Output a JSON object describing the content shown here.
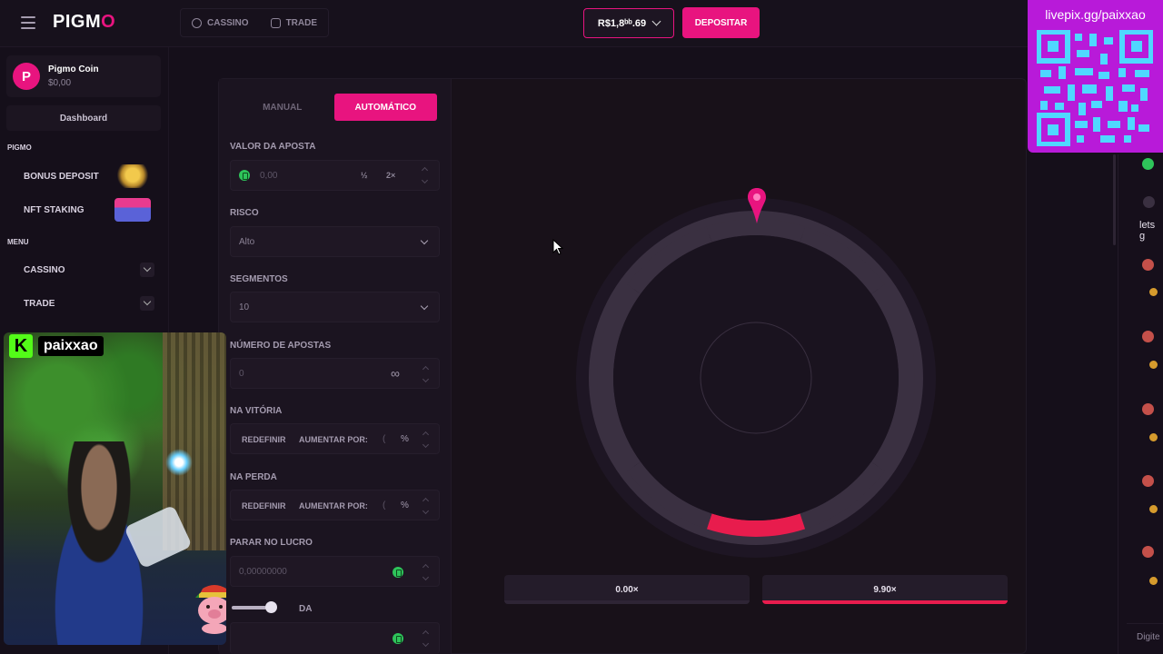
{
  "header": {
    "logo_text": "PIGM",
    "logo_o": "O",
    "nav": [
      {
        "label": "CASSINO",
        "icon": "casino-chip-icon"
      },
      {
        "label": "TRADE",
        "icon": "trade-chart-icon"
      }
    ],
    "balance": "R$1,8ᵇᵇ.69",
    "deposit_label": "DEPOSITAR"
  },
  "overlay": {
    "qr_text": "livepix.gg/paixxao",
    "streamer_name": "paixxao",
    "kick_letter": "K"
  },
  "sidebar": {
    "coin_name": "Pigmo Coin",
    "coin_balance": "$0,00",
    "avatar_letter": "P",
    "dashboard_label": "Dashboard",
    "section_pigmo": "PIGMO",
    "pigmo_items": [
      {
        "label": "BONUS DEPOSIT",
        "icon": "gift-icon"
      },
      {
        "label": "NFT STAKING",
        "icon": "treasure-chest-icon"
      }
    ],
    "section_menu": "MENU",
    "menu_items": [
      {
        "label": "CASSINO"
      },
      {
        "label": "TRADE"
      }
    ]
  },
  "bet_panel": {
    "tabs": [
      {
        "label": "MANUAL",
        "active": false
      },
      {
        "label": "AUTOMÁTICO",
        "active": true
      }
    ],
    "bet_amount": {
      "label": "VALOR DA APOSTA",
      "value": "0,00",
      "half": "½",
      "double": "2×"
    },
    "risk": {
      "label": "RISCO",
      "value": "Alto"
    },
    "segments": {
      "label": "SEGMENTOS",
      "value": "10"
    },
    "num_bets": {
      "label": "NÚMERO DE APOSTAS",
      "value": "0",
      "infinity": "∞"
    },
    "on_win": {
      "label": "NA VITÓRIA",
      "reset": "REDEFINIR",
      "increase": "AUMENTAR POR:",
      "value": "(",
      "unit": "%"
    },
    "on_loss": {
      "label": "NA PERDA",
      "reset": "REDEFINIR",
      "increase": "AUMENTAR POR:",
      "value": "(",
      "unit": "%"
    },
    "stop_profit": {
      "label": "PARAR NO LUCRO",
      "value": "0,00000000"
    },
    "stop_loss": {
      "label": "DA"
    }
  },
  "game": {
    "segments": 10,
    "highlighted_segment": 1,
    "multipliers": [
      {
        "label": "0.00×",
        "color": "#2e2535"
      },
      {
        "label": "9.90×",
        "color": "#e81c4d"
      }
    ],
    "accent": "#e8147f"
  },
  "chat": {
    "message": "lets g",
    "input_placeholder": "Digite"
  },
  "colors": {
    "brand_pink": "#e8147f",
    "background": "#150f1a",
    "win_segment": "#e81c4d",
    "coin_green": "#2ec45a"
  }
}
